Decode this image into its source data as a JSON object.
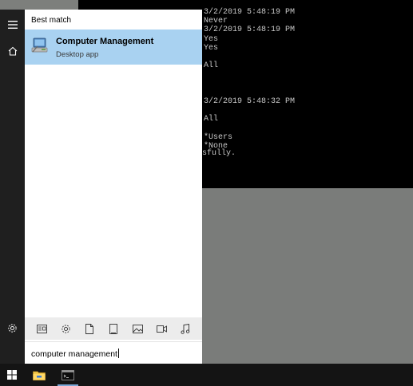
{
  "console": {
    "lines": [
      "3/2/2019 5:48:19 PM",
      "Never",
      "3/2/2019 5:48:19 PM",
      "Yes",
      "Yes",
      "",
      "All",
      "",
      "",
      "",
      "3/2/2019 5:48:32 PM",
      "",
      "All",
      "",
      "*Users",
      "*None"
    ],
    "truncated_line": "sfully."
  },
  "start_menu": {
    "section_label": "Best match",
    "best_match": {
      "title": "Computer Management",
      "subtitle": "Desktop app"
    },
    "search_query": "computer management",
    "filters": [
      "Web",
      "Settings",
      "Documents",
      "Apps",
      "Photos",
      "Videos",
      "Music"
    ]
  },
  "taskbar": {
    "items": [
      "Start",
      "File Explorer",
      "Command Prompt"
    ]
  },
  "colors": {
    "highlight": "#a9d2f1",
    "rail": "#1f1f1f",
    "taskbar": "#141414",
    "desktop": "#7a7c7a"
  }
}
